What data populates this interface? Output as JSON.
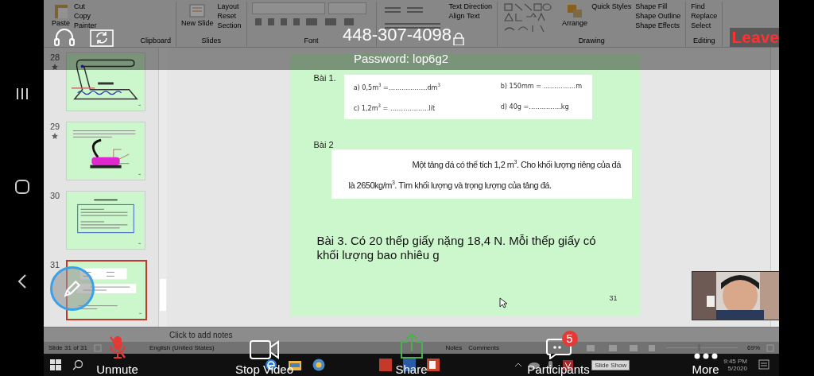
{
  "meeting": {
    "id": "448-307-4098",
    "password": "Password: lop6g2",
    "leave": "Leave"
  },
  "ribbon": {
    "groups": [
      {
        "label": "Clipboard",
        "large": "Paste",
        "items": [
          "Cut",
          "Copy",
          "Painter"
        ]
      },
      {
        "label": "Slides",
        "large": "New Slide",
        "items": [
          "Layout",
          "Reset",
          "Section"
        ]
      },
      {
        "label": "Font",
        "kind": "font"
      },
      {
        "kind": "paragraph",
        "items": [
          "Text Direction",
          "Align Text"
        ]
      },
      {
        "label": "Drawing",
        "kind": "drawing",
        "large": "Arrange",
        "items": [
          "Quick Styles"
        ],
        "more": [
          "Shape Fill",
          "Shape Outline",
          "Shape Effects"
        ]
      },
      {
        "label": "Editing",
        "items": [
          "Find",
          "Replace",
          "Select"
        ]
      }
    ]
  },
  "slides_panel": {
    "slides": [
      {
        "number": "28",
        "starred": true,
        "selected": false,
        "kind": "iron"
      },
      {
        "number": "29",
        "starred": true,
        "selected": false,
        "kind": "iron_photo"
      },
      {
        "number": "30",
        "starred": false,
        "selected": false,
        "kind": "text_box"
      },
      {
        "number": "31",
        "starred": false,
        "selected": true,
        "kind": "exercises"
      }
    ]
  },
  "slide": {
    "bai1_label": "Bài 1.",
    "bai1_items": [
      "a) 0,5m$^{3}$ =………………dm$^{3}$",
      "b) 150mm = ……………m",
      "c) 1,2m$^{3}$ = ………………lít",
      "d) 40g =……………kg"
    ],
    "bai2_label": "Bài 2",
    "bai2_text": "Một tảng đá có thể tích 1,2 m$^{3}$. Cho khối lượng riêng của đá là 2650kg/m$^{3}$. Tìm khối lượng và trọng lượng của tảng đá.",
    "bai3_text": "Bài 3. Có 20 thếp giấy nặng 18,4 N. Mỗi thếp giấy có khối lượng bao nhiêu g",
    "page_number": "31"
  },
  "notes": {
    "placeholder": "Click to add notes"
  },
  "status_bar": {
    "slide_count": "Slide 31 of 31",
    "language": "English (United States)",
    "notes": "Notes",
    "comments": "Comments",
    "zoom": "69%",
    "zoom_slider": {
      "level": 0.45
    }
  },
  "taskbar": {
    "time": "9:45 PM",
    "date": "5/2020",
    "tooltip": "Slide Show"
  },
  "controls": [
    {
      "kind": "mic",
      "label": "Unmute",
      "muted": true
    },
    {
      "kind": "video",
      "label": "Stop Video"
    },
    {
      "kind": "share",
      "label": "Share"
    },
    {
      "kind": "participants",
      "label": "Participants",
      "badge": "5"
    },
    {
      "kind": "more",
      "label": "More"
    }
  ]
}
